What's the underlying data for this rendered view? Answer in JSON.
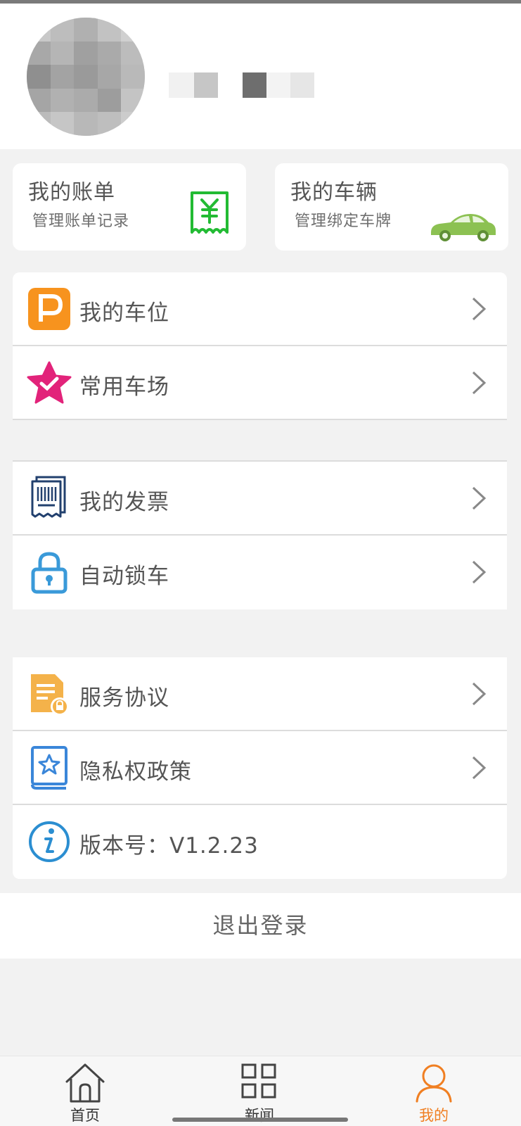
{
  "cards": {
    "bill": {
      "title": "我的账单",
      "subtitle": "管理账单记录"
    },
    "vehicle": {
      "title": "我的车辆",
      "subtitle": "管理绑定车牌"
    }
  },
  "menu": {
    "my_space": "我的车位",
    "favorite_lots": "常用车场",
    "my_invoice": "我的发票",
    "auto_lock": "自动锁车",
    "service_agreement": "服务协议",
    "privacy_policy": "隐私权政策",
    "version": "版本号：V1.2.23"
  },
  "logout_label": "退出登录",
  "tabs": [
    {
      "label": "首页",
      "icon": "home-icon"
    },
    {
      "label": "新闻",
      "icon": "grid-icon"
    },
    {
      "label": "我的",
      "icon": "person-icon"
    }
  ],
  "colors": {
    "accent_orange": "#f07f22",
    "parking_orange": "#f7931e",
    "star_pink": "#e2237a",
    "bill_green": "#22bb33",
    "car_green": "#8cc152"
  }
}
